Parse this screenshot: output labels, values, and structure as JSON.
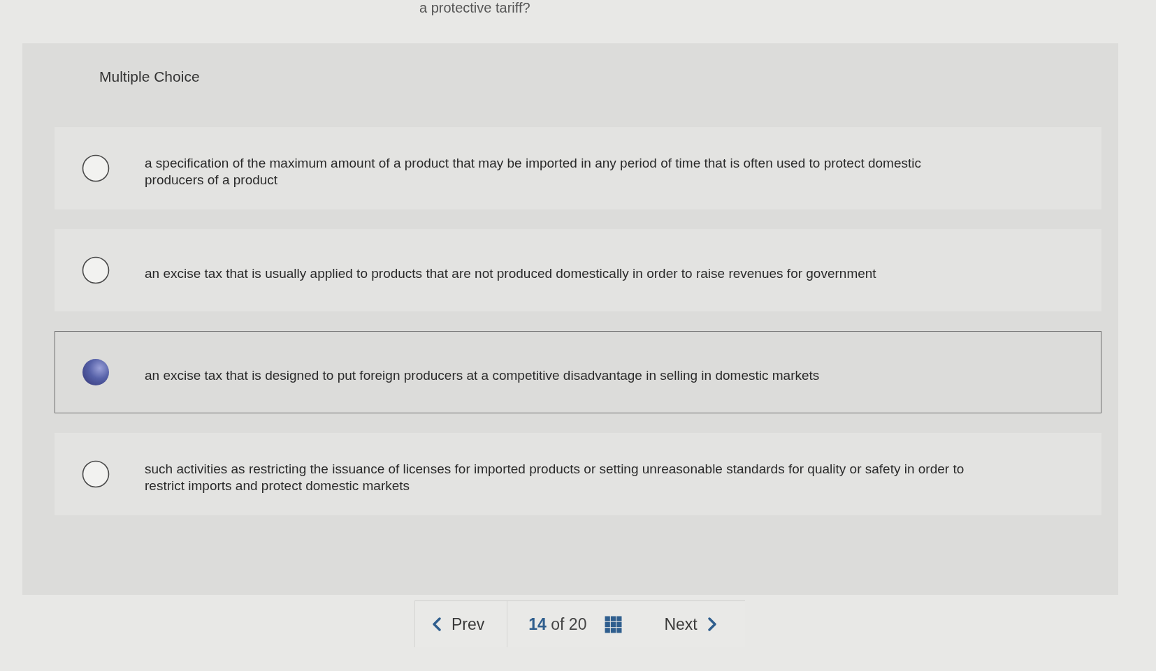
{
  "question_fragment": "a protective tariff?",
  "section_title": "Multiple Choice",
  "options": [
    {
      "text": "a specification of the maximum amount of a product that may be imported in any period of time that is often used to protect domestic producers of a product",
      "selected": false
    },
    {
      "text": "an excise tax that is usually applied to products that are not produced domestically in order to raise revenues for government",
      "selected": false
    },
    {
      "text": "an excise tax that is designed to put foreign producers at a competitive disadvantage in selling in domestic markets",
      "selected": true
    },
    {
      "text": "such activities as restricting the issuance of licenses for imported products or setting unreasonable standards for quality or safety in order to restrict imports and protect domestic markets",
      "selected": false
    }
  ],
  "pager": {
    "prev": "Prev",
    "current": "14",
    "of": "of",
    "total": "20",
    "next": "Next"
  }
}
